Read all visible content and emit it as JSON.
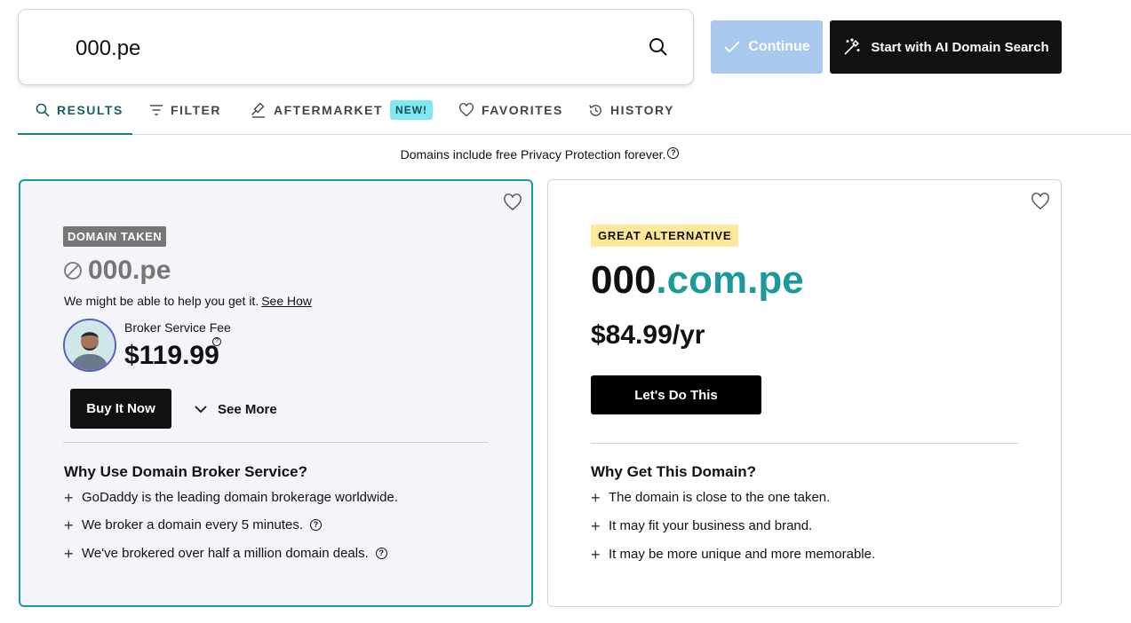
{
  "search": {
    "value": "000.pe"
  },
  "header": {
    "continue_label": "Continue",
    "ai_search_label": "Start with AI Domain Search"
  },
  "tabs": [
    {
      "label": "RESULTS",
      "active": true
    },
    {
      "label": "FILTER"
    },
    {
      "label": "AFTERMARKET",
      "badge": "NEW!"
    },
    {
      "label": "FAVORITES"
    },
    {
      "label": "HISTORY"
    }
  ],
  "privacy_note": "Domains include free Privacy Protection forever.",
  "taken_card": {
    "badge": "DOMAIN TAKEN",
    "domain": "000.pe",
    "help_text": "We might be able to help you get it.",
    "help_link": "See How",
    "fee_label": "Broker Service Fee",
    "fee_price": "$119.99",
    "buy_label": "Buy It Now",
    "see_more_label": "See More",
    "section_title": "Why Use Domain Broker Service?",
    "reasons": [
      "GoDaddy is the leading domain brokerage worldwide.",
      "We broker a domain every 5 minutes.",
      "We've brokered over half a million domain deals."
    ]
  },
  "alt_card": {
    "badge": "GREAT ALTERNATIVE",
    "domain_name": "000",
    "domain_tld": ".com.pe",
    "price": "$84.99/yr",
    "cta_label": "Let's Do This",
    "section_title": "Why Get This Domain?",
    "reasons": [
      "The domain is close to the one taken.",
      "It may fit your business and brand.",
      "It may be more unique and more memorable."
    ]
  },
  "colors": {
    "accent_teal": "#1a9a9a",
    "continue_disabled": "#a8c8ee",
    "new_badge": "#7fe8f0",
    "alt_badge": "#ffe89a",
    "taken_badge": "#767676"
  }
}
